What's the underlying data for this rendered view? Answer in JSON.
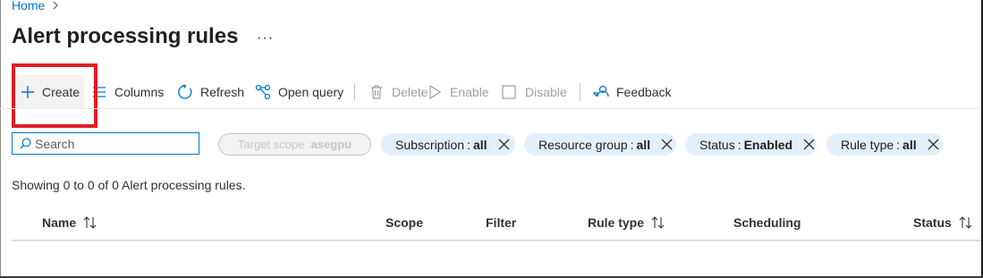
{
  "breadcrumb": {
    "home": "Home"
  },
  "page": {
    "title": "Alert processing rules",
    "more": "···"
  },
  "toolbar": {
    "create": "Create",
    "columns": "Columns",
    "refresh": "Refresh",
    "open_query": "Open query",
    "delete": "Delete",
    "enable": "Enable",
    "disable": "Disable",
    "feedback": "Feedback"
  },
  "search": {
    "placeholder": "Search"
  },
  "filters": {
    "target_scope": {
      "label": "Target scope : ",
      "value": "asegpu"
    },
    "subscription": {
      "label": "Subscription",
      "value": "all"
    },
    "resource_group": {
      "label": "Resource group",
      "value": "all"
    },
    "status": {
      "label": "Status",
      "value": "Enabled"
    },
    "rule_type": {
      "label": "Rule type",
      "value": "all"
    },
    "separator": ":"
  },
  "results": {
    "summary": "Showing 0 to 0 of 0 Alert processing rules."
  },
  "table": {
    "columns": {
      "name": "Name",
      "scope": "Scope",
      "filter": "Filter",
      "rule_type": "Rule type",
      "scheduling": "Scheduling",
      "status": "Status"
    }
  },
  "colors": {
    "accent": "#0078d4",
    "highlight": "#e11c24",
    "pill_bg": "#e3effa"
  }
}
